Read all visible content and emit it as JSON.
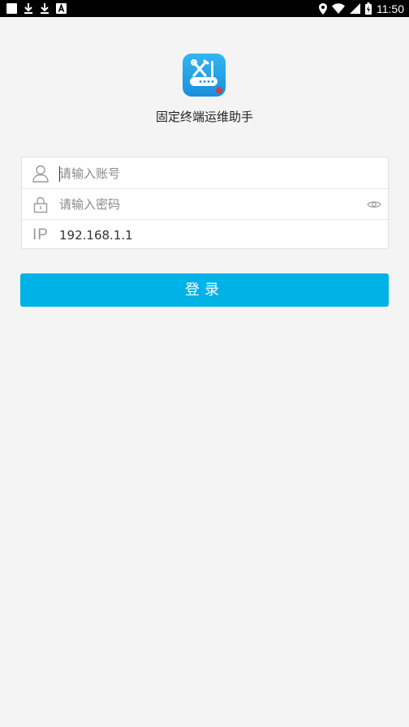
{
  "status_bar": {
    "time": "11:50",
    "icons": [
      "square-notification-icon",
      "download-icon",
      "download-icon",
      "font-icon",
      "location-icon",
      "wifi-icon",
      "signal-icon",
      "battery-icon"
    ]
  },
  "app": {
    "title": "固定终端运维助手",
    "logo_icon": "router-tools-icon"
  },
  "form": {
    "account_placeholder": "请输入账号",
    "account_value": "",
    "password_placeholder": "请输入密码",
    "password_value": "",
    "ip_label": "IP",
    "ip_value": "192.168.1.1"
  },
  "login_button": {
    "label": "登录"
  },
  "colors": {
    "accent": "#00b2e6",
    "background": "#f4f4f4",
    "status_bar": "#000000"
  }
}
